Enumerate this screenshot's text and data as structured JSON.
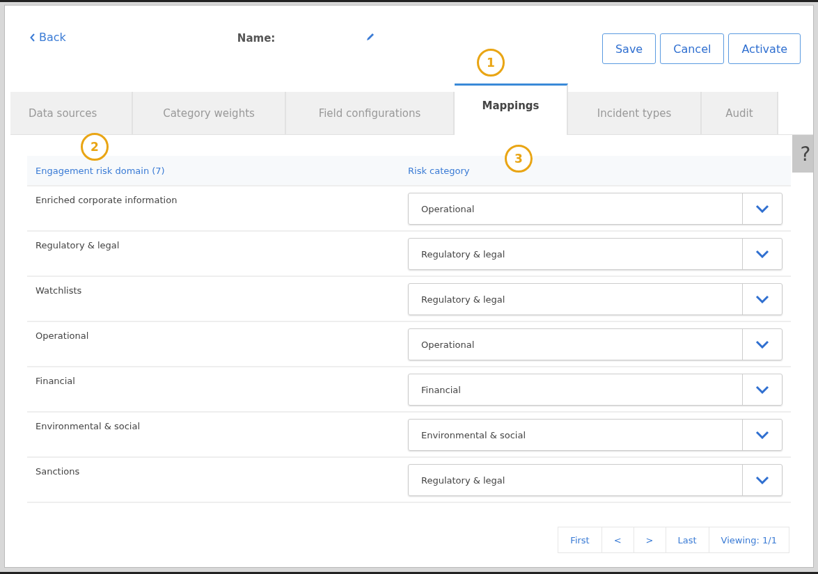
{
  "header": {
    "back": "Back",
    "name_label": "Name:",
    "buttons": [
      "Save",
      "Cancel",
      "Activate"
    ]
  },
  "tabs": [
    {
      "label": "Data sources",
      "selected": false
    },
    {
      "label": "Category weights",
      "selected": false
    },
    {
      "label": "Field configurations",
      "selected": false
    },
    {
      "label": "Mappings",
      "selected": true
    },
    {
      "label": "Incident types",
      "selected": false
    },
    {
      "label": "Audit",
      "selected": false
    }
  ],
  "help": "?",
  "callouts": [
    "1",
    "2",
    "3"
  ],
  "table": {
    "columns": [
      "Engagement risk domain (7)",
      "Risk category"
    ],
    "rows": [
      {
        "domain": "Enriched corporate information",
        "category": "Operational"
      },
      {
        "domain": "Regulatory & legal",
        "category": "Regulatory & legal"
      },
      {
        "domain": "Watchlists",
        "category": "Regulatory & legal"
      },
      {
        "domain": "Operational",
        "category": "Operational"
      },
      {
        "domain": "Financial",
        "category": "Financial"
      },
      {
        "domain": "Environmental & social",
        "category": "Environmental & social"
      },
      {
        "domain": "Sanctions",
        "category": "Regulatory & legal"
      }
    ]
  },
  "pagination": {
    "first": "First",
    "prev": "<",
    "next": ">",
    "last": "Last",
    "viewing": "Viewing: 1/1"
  }
}
